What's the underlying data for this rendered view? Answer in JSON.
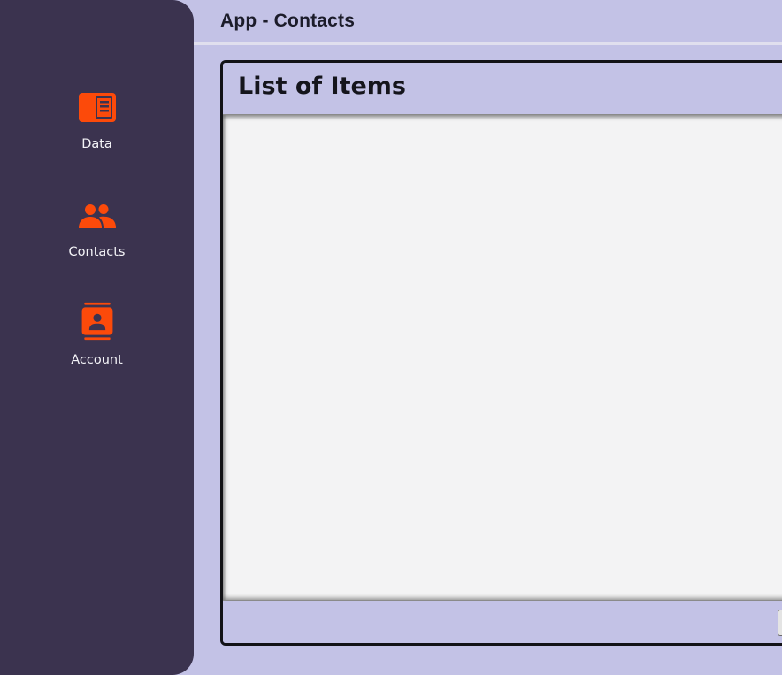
{
  "app": {
    "title": "App - Contacts"
  },
  "sidebar": {
    "accent_color": "#fc4a0a",
    "background_color": "#3b334f",
    "items": [
      {
        "label": "Data",
        "icon": "data-card-icon"
      },
      {
        "label": "Contacts",
        "icon": "people-icon"
      },
      {
        "label": "Account",
        "icon": "contact-card-icon"
      }
    ]
  },
  "main": {
    "panel_title": "List of Items",
    "items": []
  }
}
